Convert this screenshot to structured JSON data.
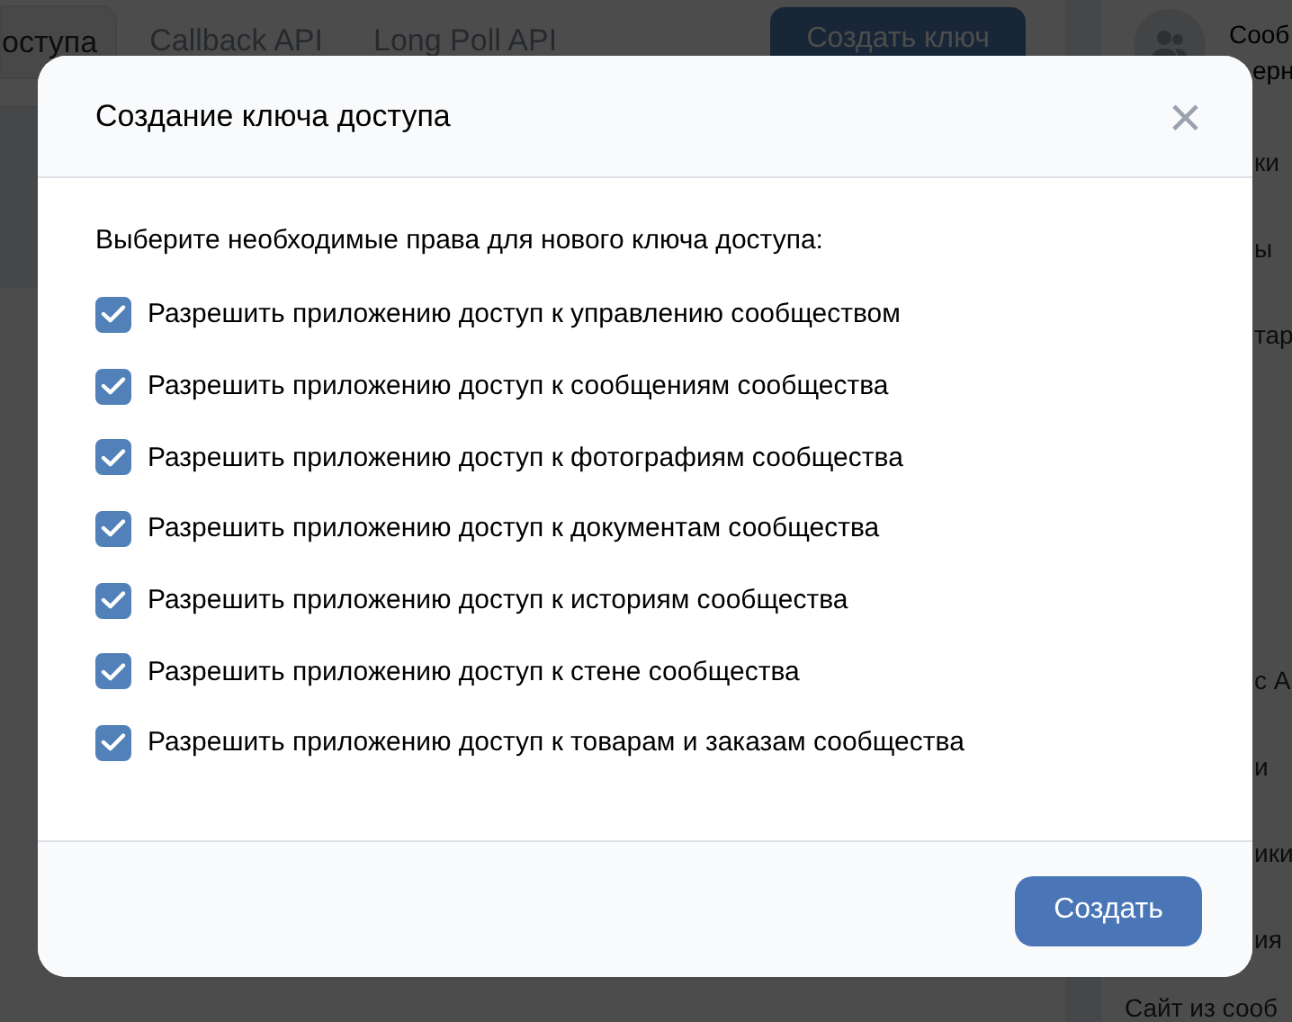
{
  "background_page": {
    "tabs": [
      {
        "label": "оступа",
        "selected": true
      },
      {
        "label": "Callback API",
        "selected": false
      },
      {
        "label": "Long Poll API",
        "selected": false
      }
    ],
    "create_key_button": "Создать ключ",
    "sidebar": {
      "header_lines": [
        "Сооб",
        "ерн"
      ],
      "items": [
        {
          "label": "ки",
          "kind": "covered"
        },
        {
          "label": "ы",
          "kind": "covered"
        },
        {
          "label": "тар",
          "kind": "covered"
        },
        {
          "label": "с A",
          "kind": "covered"
        },
        {
          "label": "и",
          "kind": "covered"
        },
        {
          "label": "ики",
          "kind": "covered"
        },
        {
          "label": "ия",
          "kind": "covered"
        },
        {
          "label": "Сайт из сооб",
          "kind": "full"
        }
      ]
    }
  },
  "dialog": {
    "title": "Создание ключа доступа",
    "close": "×",
    "prompt": "Выберите необходимые права для нового ключа доступа:",
    "permissions": [
      {
        "label": "Разрешить приложению доступ к управлению сообществом",
        "checked": true
      },
      {
        "label": "Разрешить приложению доступ к сообщениям сообщества",
        "checked": true
      },
      {
        "label": "Разрешить приложению доступ к фотографиям сообщества",
        "checked": true
      },
      {
        "label": "Разрешить приложению доступ к документам сообщества",
        "checked": true
      },
      {
        "label": "Разрешить приложению доступ к историям сообщества",
        "checked": true
      },
      {
        "label": "Разрешить приложению доступ к стене сообщества",
        "checked": true
      },
      {
        "label": "Разрешить приложению доступ к товарам и заказам сообщества",
        "checked": true
      }
    ],
    "submit_button": "Создать"
  }
}
